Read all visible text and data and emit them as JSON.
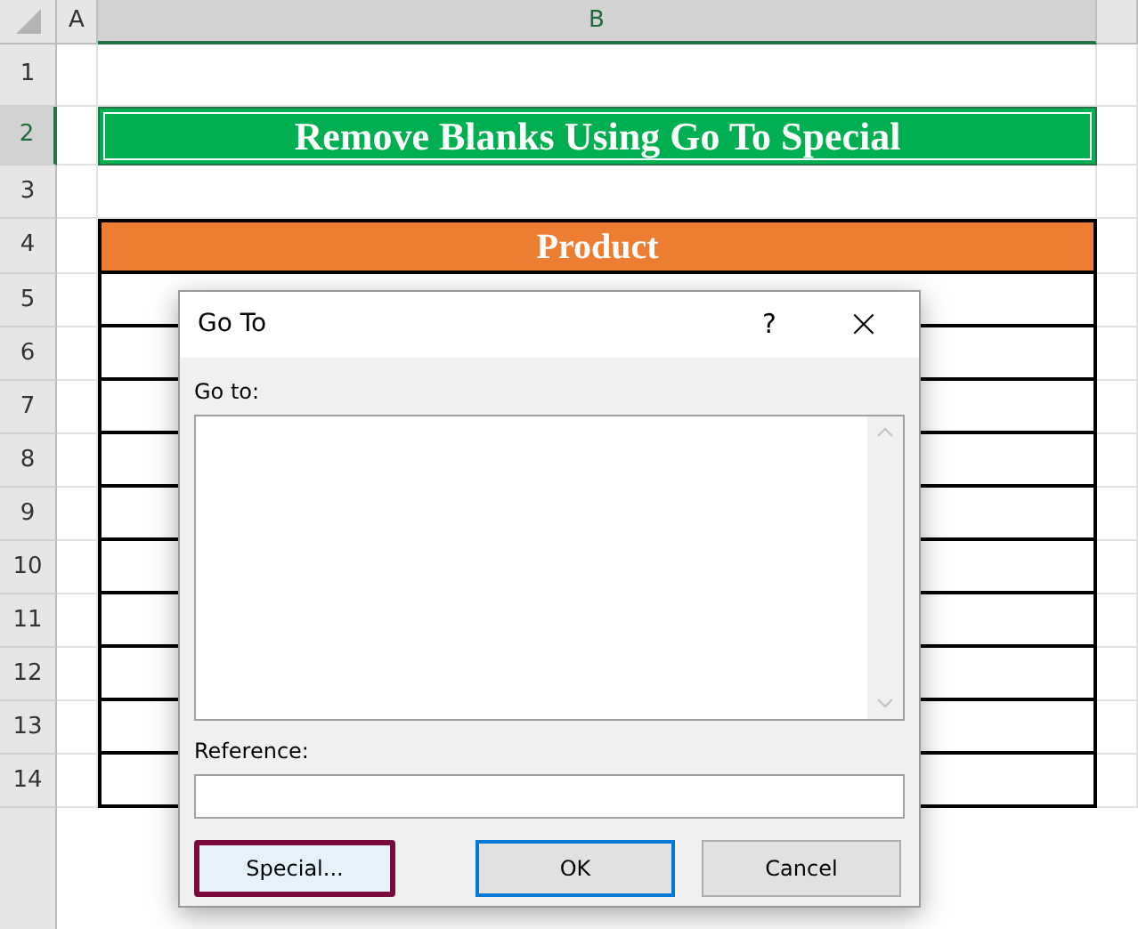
{
  "sheet": {
    "columns": [
      {
        "label": "A",
        "selected": false
      },
      {
        "label": "B",
        "selected": true
      }
    ],
    "rows": [
      {
        "label": "1",
        "selected": false
      },
      {
        "label": "2",
        "selected": true
      },
      {
        "label": "3",
        "selected": false
      },
      {
        "label": "4",
        "selected": false
      },
      {
        "label": "5",
        "selected": false
      },
      {
        "label": "6",
        "selected": false
      },
      {
        "label": "7",
        "selected": false
      },
      {
        "label": "8",
        "selected": false
      },
      {
        "label": "9",
        "selected": false
      },
      {
        "label": "10",
        "selected": false
      },
      {
        "label": "11",
        "selected": false
      },
      {
        "label": "12",
        "selected": false
      },
      {
        "label": "13",
        "selected": false
      },
      {
        "label": "14",
        "selected": false
      }
    ],
    "title": "Remove Blanks Using Go To Special",
    "table_header": "Product"
  },
  "dialog": {
    "title": "Go To",
    "help": "?",
    "close": "×",
    "goto_label": "Go to:",
    "reference_label": "Reference:",
    "buttons": [
      {
        "label": "Special...",
        "focused": true,
        "default": false
      },
      {
        "label": "OK",
        "focused": false,
        "default": true
      },
      {
        "label": "Cancel",
        "focused": false,
        "default": false
      }
    ]
  }
}
